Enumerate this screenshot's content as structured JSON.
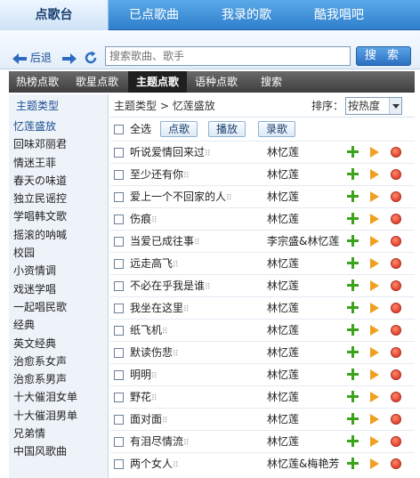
{
  "top_tabs": [
    "点歌台",
    "已点歌曲",
    "我录的歌",
    "酷我唱吧"
  ],
  "nav": {
    "back_label": "后退"
  },
  "search": {
    "placeholder": "搜索歌曲、歌手",
    "button_label": "搜 索"
  },
  "sub_tabs": [
    "热榜点歌",
    "歌星点歌",
    "主题点歌",
    "语种点歌",
    "搜索"
  ],
  "sidebar": {
    "header": "主题类型",
    "items": [
      "忆莲盛放",
      "回味邓丽君",
      "情迷王菲",
      "春天の味道",
      "独立民谣控",
      "学唱韩文歌",
      "摇滚的呐喊",
      "校园",
      "小资情调",
      "戏迷学唱",
      "一起唱民歌",
      "经典",
      "英文经典",
      "治愈系女声",
      "治愈系男声",
      "十大催泪女单",
      "十大催泪男单",
      "兄弟情",
      "中国风歌曲"
    ]
  },
  "breadcrumb": {
    "root": "主题类型",
    "sep": ">",
    "current": "忆莲盛放"
  },
  "sort": {
    "label": "排序：",
    "value": "按热度"
  },
  "actions": {
    "select_all": "全选",
    "order": "点歌",
    "play": "播放",
    "record": "录歌"
  },
  "songs": [
    {
      "title": "听说爱情回来过",
      "artist": "林忆莲"
    },
    {
      "title": "至少还有你",
      "artist": "林忆莲"
    },
    {
      "title": "爱上一个不回家的人",
      "artist": "林忆莲"
    },
    {
      "title": "伤痕",
      "artist": "林忆莲"
    },
    {
      "title": "当爱已成往事",
      "artist": "李宗盛&林忆莲"
    },
    {
      "title": "远走高飞",
      "artist": "林忆莲"
    },
    {
      "title": "不必在乎我是谁",
      "artist": "林忆莲"
    },
    {
      "title": "我坐在这里",
      "artist": "林忆莲"
    },
    {
      "title": "纸飞机",
      "artist": "林忆莲"
    },
    {
      "title": "默读伤悲",
      "artist": "林忆莲"
    },
    {
      "title": "明明",
      "artist": "林忆莲"
    },
    {
      "title": "野花",
      "artist": "林忆莲"
    },
    {
      "title": "面对面",
      "artist": "林忆莲"
    },
    {
      "title": "有泪尽情流",
      "artist": "林忆莲"
    },
    {
      "title": "两个女人",
      "artist": "林忆莲&梅艳芳"
    }
  ],
  "icons": {
    "back": "back-arrow-icon",
    "forward": "forward-arrow-icon",
    "refresh": "refresh-icon",
    "add": "add-icon",
    "play": "play-icon",
    "record": "record-icon"
  }
}
